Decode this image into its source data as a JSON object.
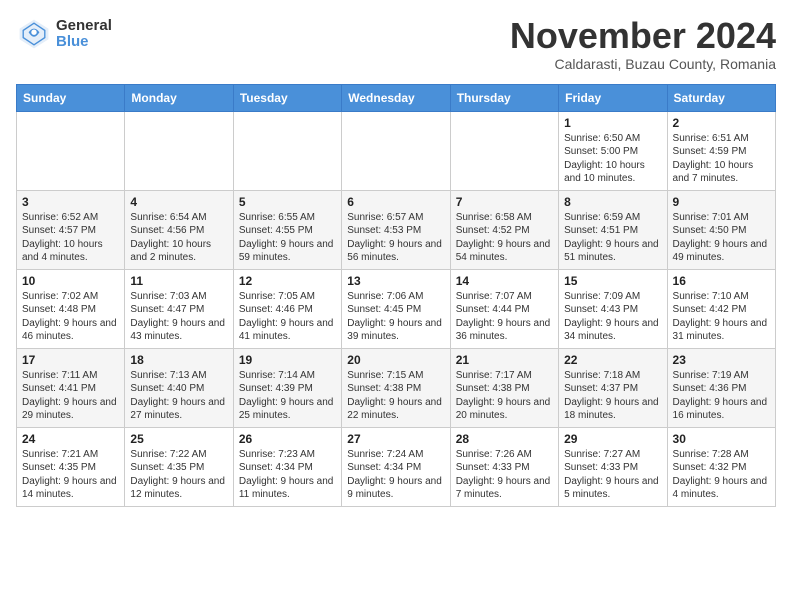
{
  "header": {
    "logo_general": "General",
    "logo_blue": "Blue",
    "month_title": "November 2024",
    "location": "Caldarasti, Buzau County, Romania"
  },
  "weekdays": [
    "Sunday",
    "Monday",
    "Tuesday",
    "Wednesday",
    "Thursday",
    "Friday",
    "Saturday"
  ],
  "weeks": [
    [
      {
        "day": "",
        "info": ""
      },
      {
        "day": "",
        "info": ""
      },
      {
        "day": "",
        "info": ""
      },
      {
        "day": "",
        "info": ""
      },
      {
        "day": "",
        "info": ""
      },
      {
        "day": "1",
        "info": "Sunrise: 6:50 AM\nSunset: 5:00 PM\nDaylight: 10 hours and 10 minutes."
      },
      {
        "day": "2",
        "info": "Sunrise: 6:51 AM\nSunset: 4:59 PM\nDaylight: 10 hours and 7 minutes."
      }
    ],
    [
      {
        "day": "3",
        "info": "Sunrise: 6:52 AM\nSunset: 4:57 PM\nDaylight: 10 hours and 4 minutes."
      },
      {
        "day": "4",
        "info": "Sunrise: 6:54 AM\nSunset: 4:56 PM\nDaylight: 10 hours and 2 minutes."
      },
      {
        "day": "5",
        "info": "Sunrise: 6:55 AM\nSunset: 4:55 PM\nDaylight: 9 hours and 59 minutes."
      },
      {
        "day": "6",
        "info": "Sunrise: 6:57 AM\nSunset: 4:53 PM\nDaylight: 9 hours and 56 minutes."
      },
      {
        "day": "7",
        "info": "Sunrise: 6:58 AM\nSunset: 4:52 PM\nDaylight: 9 hours and 54 minutes."
      },
      {
        "day": "8",
        "info": "Sunrise: 6:59 AM\nSunset: 4:51 PM\nDaylight: 9 hours and 51 minutes."
      },
      {
        "day": "9",
        "info": "Sunrise: 7:01 AM\nSunset: 4:50 PM\nDaylight: 9 hours and 49 minutes."
      }
    ],
    [
      {
        "day": "10",
        "info": "Sunrise: 7:02 AM\nSunset: 4:48 PM\nDaylight: 9 hours and 46 minutes."
      },
      {
        "day": "11",
        "info": "Sunrise: 7:03 AM\nSunset: 4:47 PM\nDaylight: 9 hours and 43 minutes."
      },
      {
        "day": "12",
        "info": "Sunrise: 7:05 AM\nSunset: 4:46 PM\nDaylight: 9 hours and 41 minutes."
      },
      {
        "day": "13",
        "info": "Sunrise: 7:06 AM\nSunset: 4:45 PM\nDaylight: 9 hours and 39 minutes."
      },
      {
        "day": "14",
        "info": "Sunrise: 7:07 AM\nSunset: 4:44 PM\nDaylight: 9 hours and 36 minutes."
      },
      {
        "day": "15",
        "info": "Sunrise: 7:09 AM\nSunset: 4:43 PM\nDaylight: 9 hours and 34 minutes."
      },
      {
        "day": "16",
        "info": "Sunrise: 7:10 AM\nSunset: 4:42 PM\nDaylight: 9 hours and 31 minutes."
      }
    ],
    [
      {
        "day": "17",
        "info": "Sunrise: 7:11 AM\nSunset: 4:41 PM\nDaylight: 9 hours and 29 minutes."
      },
      {
        "day": "18",
        "info": "Sunrise: 7:13 AM\nSunset: 4:40 PM\nDaylight: 9 hours and 27 minutes."
      },
      {
        "day": "19",
        "info": "Sunrise: 7:14 AM\nSunset: 4:39 PM\nDaylight: 9 hours and 25 minutes."
      },
      {
        "day": "20",
        "info": "Sunrise: 7:15 AM\nSunset: 4:38 PM\nDaylight: 9 hours and 22 minutes."
      },
      {
        "day": "21",
        "info": "Sunrise: 7:17 AM\nSunset: 4:38 PM\nDaylight: 9 hours and 20 minutes."
      },
      {
        "day": "22",
        "info": "Sunrise: 7:18 AM\nSunset: 4:37 PM\nDaylight: 9 hours and 18 minutes."
      },
      {
        "day": "23",
        "info": "Sunrise: 7:19 AM\nSunset: 4:36 PM\nDaylight: 9 hours and 16 minutes."
      }
    ],
    [
      {
        "day": "24",
        "info": "Sunrise: 7:21 AM\nSunset: 4:35 PM\nDaylight: 9 hours and 14 minutes."
      },
      {
        "day": "25",
        "info": "Sunrise: 7:22 AM\nSunset: 4:35 PM\nDaylight: 9 hours and 12 minutes."
      },
      {
        "day": "26",
        "info": "Sunrise: 7:23 AM\nSunset: 4:34 PM\nDaylight: 9 hours and 11 minutes."
      },
      {
        "day": "27",
        "info": "Sunrise: 7:24 AM\nSunset: 4:34 PM\nDaylight: 9 hours and 9 minutes."
      },
      {
        "day": "28",
        "info": "Sunrise: 7:26 AM\nSunset: 4:33 PM\nDaylight: 9 hours and 7 minutes."
      },
      {
        "day": "29",
        "info": "Sunrise: 7:27 AM\nSunset: 4:33 PM\nDaylight: 9 hours and 5 minutes."
      },
      {
        "day": "30",
        "info": "Sunrise: 7:28 AM\nSunset: 4:32 PM\nDaylight: 9 hours and 4 minutes."
      }
    ]
  ]
}
